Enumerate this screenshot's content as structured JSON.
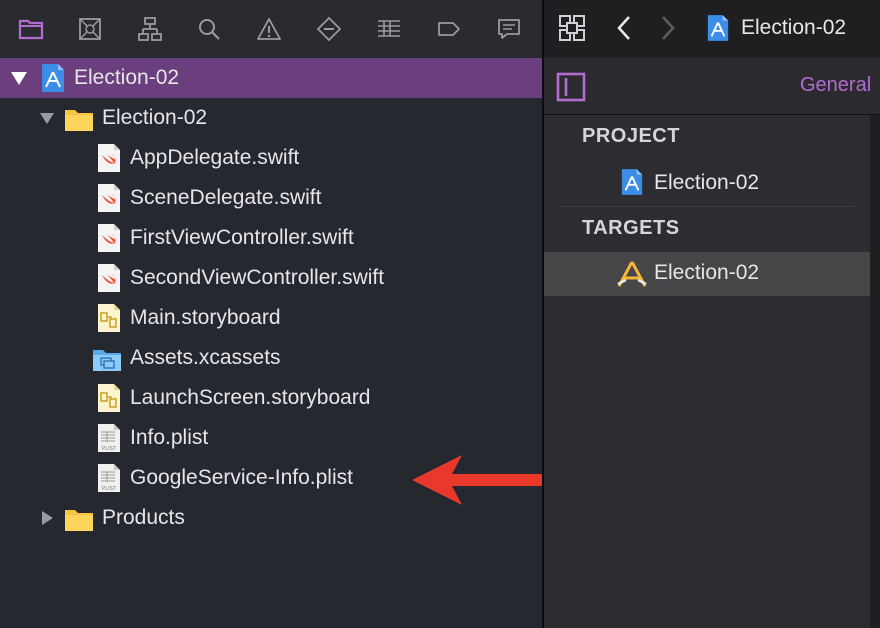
{
  "navigator": {
    "toolbar_icons": [
      {
        "name": "folder-icon",
        "active": true
      },
      {
        "name": "source-control-icon",
        "active": false
      },
      {
        "name": "symbol-hierarchy-icon",
        "active": false
      },
      {
        "name": "search-icon",
        "active": false
      },
      {
        "name": "warning-icon",
        "active": false
      },
      {
        "name": "test-diamond-icon",
        "active": false
      },
      {
        "name": "debug-list-icon",
        "active": false
      },
      {
        "name": "breakpoint-tag-icon",
        "active": false
      },
      {
        "name": "report-bubble-icon",
        "active": false
      }
    ],
    "tree": [
      {
        "label": "Election-02",
        "icon": "xcode-project-icon",
        "level": 0,
        "disclosure": "expanded",
        "selected": true
      },
      {
        "label": "Election-02",
        "icon": "folder-icon",
        "level": 1,
        "disclosure": "expanded"
      },
      {
        "label": "AppDelegate.swift",
        "icon": "swift-file-icon",
        "level": 2
      },
      {
        "label": "SceneDelegate.swift",
        "icon": "swift-file-icon",
        "level": 2
      },
      {
        "label": "FirstViewController.swift",
        "icon": "swift-file-icon",
        "level": 2
      },
      {
        "label": "SecondViewController.swift",
        "icon": "swift-file-icon",
        "level": 2
      },
      {
        "label": "Main.storyboard",
        "icon": "storyboard-file-icon",
        "level": 2
      },
      {
        "label": "Assets.xcassets",
        "icon": "assets-folder-icon",
        "level": 2
      },
      {
        "label": "LaunchScreen.storyboard",
        "icon": "storyboard-file-icon",
        "level": 2
      },
      {
        "label": "Info.plist",
        "icon": "plist-file-icon",
        "level": 2
      },
      {
        "label": "GoogleService-Info.plist",
        "icon": "plist-file-icon",
        "level": 2
      },
      {
        "label": "Products",
        "icon": "folder-icon",
        "level": 1,
        "disclosure": "collapsed"
      }
    ],
    "plist_icon_caption": "PLIST",
    "annotation_arrow_color": "#e8392b"
  },
  "editor": {
    "breadcrumb": "Election-02",
    "tab_general": "General",
    "project_section": "PROJECT",
    "project_item": "Election-02",
    "targets_section": "TARGETS",
    "target_item": "Election-02"
  },
  "colors": {
    "accent_purple": "#b26bd0",
    "selection": "#6b3f7d",
    "swift": "#f05138"
  }
}
